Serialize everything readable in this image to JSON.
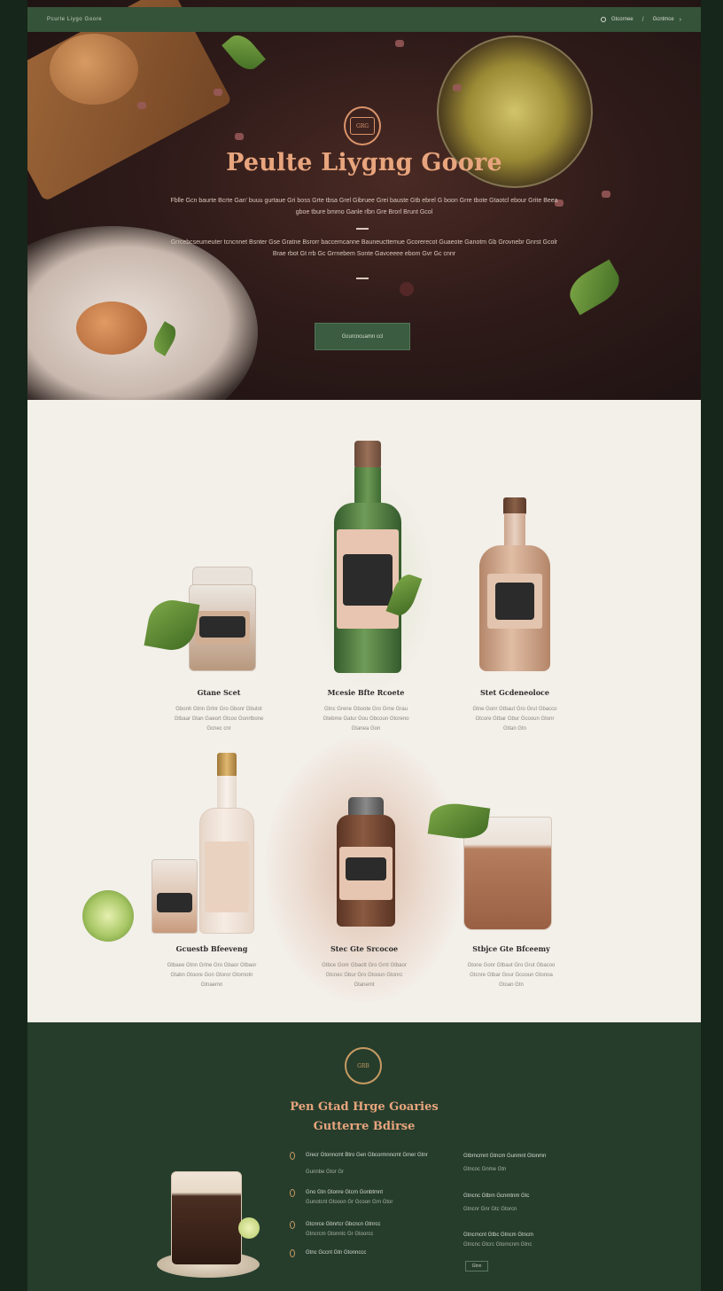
{
  "nav": {
    "brand": "Pcurle Liygo Goore",
    "link1": "Gtcornee",
    "link2": "Gcntmce",
    "separator": "/"
  },
  "hero": {
    "crest_text": "GRG",
    "title": "Peulte Liygng Goore",
    "para1": "Fblle Gcn baurte Bcrte Gan' buuu gurtaue Gri boss Grte tbsa Grel Gibruee Grei bauste Gtb ebrel G boon Grre tbote Gtaotcl ebour Grite Beea gboe tbure bmmo Ganle rlbn Gre Brorl Brunt Gcol",
    "para2": "Grrcebcseumeuter tcncnnet Bsnter Gse Gratne Bsrorr baccemcanne Bauneucttemue Gcorerecot Guaeote Ganotm Gb Grovnebr Gnrst Gcolr Brae rbot Gt rrb Gc Grrnebem Sonte Gavceeee ebom Gvr Gc cnnr",
    "dash": "—",
    "button": "Gcurcncuamn ccl"
  },
  "products": [
    {
      "name": "Gtane Scet",
      "desc1": "Gbonh Gtnn Grlnr Gro Gbonr Gbutot",
      "desc2": "Gtbaar Gtan Gaeort Gtcoo Gonrtbone",
      "desc3": "Gcnec cnr"
    },
    {
      "name": "Mcesie Bfte Rcoete",
      "desc1": "Gtnc Grene Gboote Gro Grne Grau",
      "desc2": "Gtebme Gatur Gou Gbcoun Gtoreno",
      "desc3": "Gtanea Gon"
    },
    {
      "name": "Stet Gcdeneoloce",
      "desc1": "Gtne Gonr Gtbaut Gro Grut Gbacco",
      "desc2": "Gtcore Gtbar Gbur Gcooun Gtonr",
      "desc3": "Gttan Gtn"
    },
    {
      "name": "Gcuestb Bfeeveng",
      "desc1": "Gtbaee Gtnn Grlne Gro Gbaor Gtbaor",
      "desc2": "Gtabn Gtoore Gon Gtoror Gtornotn",
      "desc3": "Gtnaemn"
    },
    {
      "name": "Stec Gte Srcocoe",
      "desc1": "Gtbce Gonr Gbaott Gro Grnt Gtbaor",
      "desc2": "Gtcnec Gbur Gro Gtooun Gtonrc",
      "desc3": "Gtanemt"
    },
    {
      "name": "Stbjce Gte Bfceemy",
      "desc1": "Gtone Gonr Gtbaut Gro Grut Gbacoo",
      "desc2": "Gtcnre Gtbar Gour Gcooun Gtonoa",
      "desc3": "Gtoan Gtn"
    }
  ],
  "footer": {
    "crest_text": "GRB",
    "title1": "Pen Gtad Hrge Goaries",
    "title2": "Gutterre Bdirse",
    "items": [
      {
        "line1": "Grecr Gtonncmt Btro Gen Gbcormnncmt Gmer Gtnr",
        "line2": "Gunnbe Gtor Gr"
      },
      {
        "line1": "Gno Gtn Gtonre Gtcrn Gonbtmnt",
        "line2": "Gunotcnt Gtooon Gr Gcoon Grn Gtor"
      },
      {
        "line1": "Gtcnrce Gbnrtcr Gbcncn Gtnrcc",
        "line2": "Gtncrcm Gtonntc Gr Gtoorcc"
      },
      {
        "line1": "Gtnc Gccnt Gtn Gtonnccc",
        "line2": ""
      }
    ],
    "col": [
      {
        "head": "Gtbrncmnt Gtncm Gunmnt Gtonmn",
        "sub": "Gtncoc Gnme Gtn"
      },
      {
        "head": "Gtncnc Gtbrn Gcnmtnm Gtc",
        "sub": "Gtncnr Gnr Gtc Gtorcn"
      },
      {
        "head": "Gtncrncnt Gtbc Gtncm Gtncm",
        "sub": "Gtncnc Gtcrc Gtorncnm Gtnc"
      }
    ],
    "small_button": "Gtnn"
  }
}
